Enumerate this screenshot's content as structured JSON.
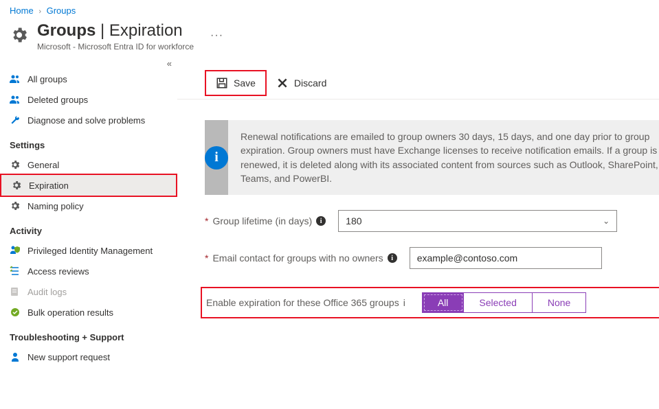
{
  "breadcrumb": {
    "home": "Home",
    "groups": "Groups"
  },
  "header": {
    "title_bold": "Groups",
    "title_sep": " | ",
    "title_rest": "Expiration",
    "subtitle": "Microsoft - Microsoft Entra ID for workforce"
  },
  "sidebar": {
    "items_top": [
      {
        "label": "All groups"
      },
      {
        "label": "Deleted groups"
      },
      {
        "label": "Diagnose and solve problems"
      }
    ],
    "section_settings": "Settings",
    "items_settings": [
      {
        "label": "General"
      },
      {
        "label": "Expiration"
      },
      {
        "label": "Naming policy"
      }
    ],
    "section_activity": "Activity",
    "items_activity": [
      {
        "label": "Privileged Identity Management"
      },
      {
        "label": "Access reviews"
      },
      {
        "label": "Audit logs"
      },
      {
        "label": "Bulk operation results"
      }
    ],
    "section_trouble": "Troubleshooting + Support",
    "items_trouble": [
      {
        "label": "New support request"
      }
    ]
  },
  "toolbar": {
    "save": "Save",
    "discard": "Discard"
  },
  "info": {
    "text": "Renewal notifications are emailed to group owners 30 days, 15 days, and one day prior to group expiration. Group owners must have Exchange licenses to receive notification emails. If a group is not renewed, it is deleted along with its associated content from sources such as Outlook, SharePoint, Teams, and PowerBI."
  },
  "form": {
    "lifetime_label": "Group lifetime (in days)",
    "lifetime_value": "180",
    "email_label": "Email contact for groups with no owners",
    "email_value": "example@contoso.com",
    "enable_label": "Enable expiration for these Office 365 groups",
    "opt_all": "All",
    "opt_selected": "Selected",
    "opt_none": "None"
  }
}
